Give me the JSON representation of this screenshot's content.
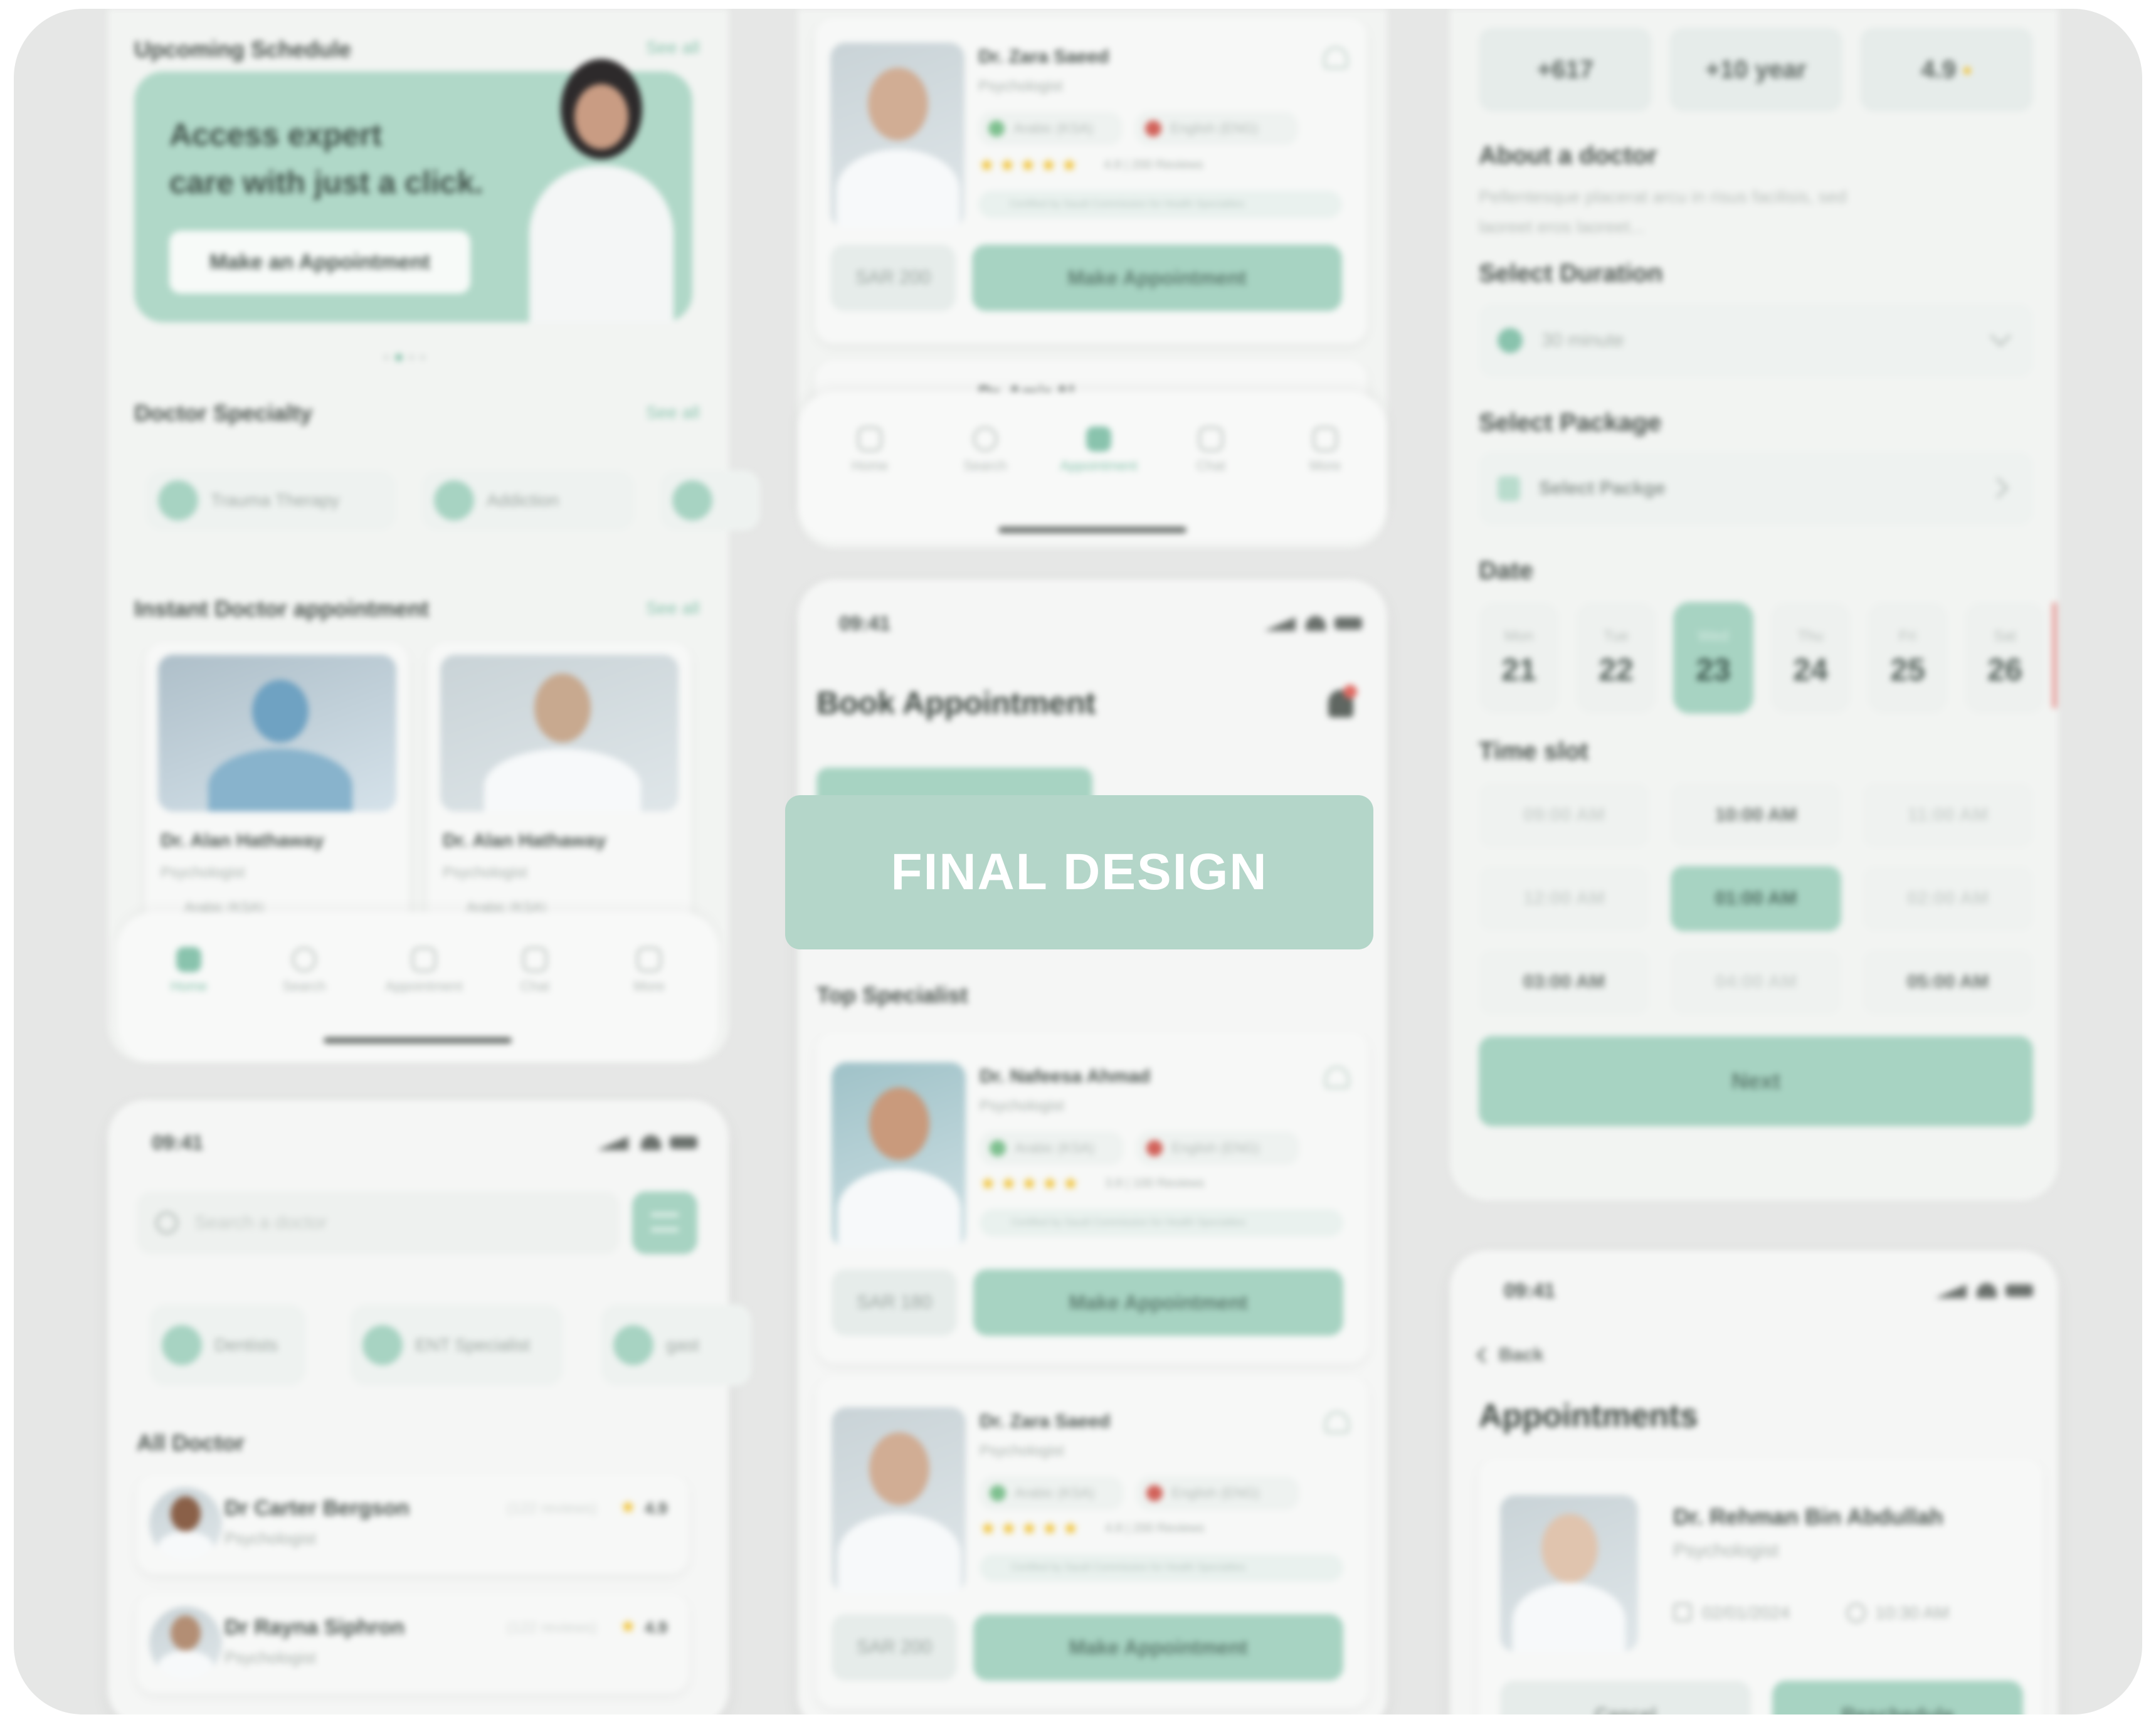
{
  "overlay": {
    "label": "FINAL DESIGN"
  },
  "colors": {
    "accent": "#a7d3c2",
    "accent_text": "#89c3ad",
    "background": "#e6e7e6",
    "star": "#f1c233"
  },
  "home": {
    "upcoming_title": "Upcoming Schedule",
    "see_all": "See all",
    "banner_line1": "Access expert",
    "banner_line2": "care with just a click.",
    "banner_button": "Make an Appointment",
    "specialty_title": "Doctor Specialty",
    "specialties": [
      {
        "label": "Trauma Therapy"
      },
      {
        "label": "Addiction"
      }
    ],
    "instant_title": "Instant Doctor appointment",
    "instant_doctors": [
      {
        "name": "Dr. Alan Hathaway",
        "role": "Psychologist",
        "lang": "Arabic (KSA)"
      },
      {
        "name": "Dr. Alan Hathaway",
        "role": "Psychologist",
        "lang": "Arabic (KSA)"
      }
    ],
    "nav": [
      {
        "label": "Home"
      },
      {
        "label": "Search"
      },
      {
        "label": "Appointment"
      },
      {
        "label": "Chat"
      },
      {
        "label": "More"
      }
    ]
  },
  "search_screen": {
    "time": "09:41",
    "search_placeholder": "Search a doctor",
    "chips": [
      {
        "label": "Dentists"
      },
      {
        "label": "ENT Specialist"
      },
      {
        "label": "gast"
      }
    ],
    "all_title": "All Doctor",
    "doctors": [
      {
        "name": "Dr Carter Bergson",
        "role": "Psychologist",
        "reviews": "(122 reviews)",
        "rating": "4.9"
      },
      {
        "name": "Dr Rayna Siphron",
        "role": "Psychologist",
        "reviews": "(122 reviews)",
        "rating": "4.9"
      }
    ]
  },
  "list_top": {
    "doctor": {
      "name": "Dr. Zara Saeed",
      "role": "Psychologist",
      "lang1": "Arabic (KSA)",
      "lang2": "English (ENG)",
      "rating_text": "4.8 | 200 Reviews",
      "cert": "Certified by Saudi Commission for Health Specialties",
      "price": "SAR 200",
      "button": "Make Appointment"
    },
    "next_name": "Dr. Amir Al",
    "nav": [
      {
        "label": "Home"
      },
      {
        "label": "Search"
      },
      {
        "label": "Appointment"
      },
      {
        "label": "Chat"
      },
      {
        "label": "More"
      }
    ]
  },
  "book": {
    "time": "09:41",
    "title": "Book Appointment",
    "top_specialist": "Top Specialist",
    "doctors": [
      {
        "name": "Dr. Nafeesa Ahmad",
        "role": "Psychologist",
        "lang1": "Arabic (KSA)",
        "lang2": "English (ENG)",
        "rating_text": "3.8 | 100 Reviews",
        "cert": "Certified by Saudi Commission for Health Specialties",
        "price": "SAR 180",
        "button": "Make Appointment"
      },
      {
        "name": "Dr. Zara Saeed",
        "role": "Psychologist",
        "lang1": "Arabic (KSA)",
        "lang2": "English (ENG)",
        "rating_text": "4.8 | 200 Reviews",
        "cert": "Certified by Saudi Commission for Health Specialties",
        "price": "SAR 200",
        "button": "Make Appointment"
      }
    ]
  },
  "details": {
    "stats": [
      {
        "value": "+617"
      },
      {
        "value": "+10 year"
      },
      {
        "value": "4.9"
      }
    ],
    "about_title": "About a doctor",
    "about_line1": "Pellentesque placerat arcu in risus facilisis, sed",
    "about_line2": "laoreet eros laoreet...",
    "duration_title": "Select Duration",
    "duration_value": "30 minute",
    "package_title": "Select Package",
    "package_value": "Select Packge",
    "date_title": "Date",
    "dates": [
      {
        "day": "Mon",
        "num": "21"
      },
      {
        "day": "Tue",
        "num": "22"
      },
      {
        "day": "Wed",
        "num": "23"
      },
      {
        "day": "Thu",
        "num": "24"
      },
      {
        "day": "Fri",
        "num": "25"
      },
      {
        "day": "Sat",
        "num": "26"
      }
    ],
    "selected_date_index": 2,
    "timeslot_title": "Time slot",
    "slots": [
      "09:00 AM",
      "10:00 AM",
      "11:00 AM",
      "12:00 AM",
      "01:00 AM",
      "02:00 AM",
      "03:00 AM",
      "04:00 AM",
      "05:00 AM"
    ],
    "selected_slot_index": 4,
    "next_button": "Next"
  },
  "appointments": {
    "time": "09:41",
    "back": "Back",
    "title": "Appointments",
    "doctor_name": "Dr. Rehman Bin Abdullah",
    "doctor_role": "Psychologist",
    "date": "02/01/2024",
    "time_value": "10:30 AM",
    "cancel": "Cancel",
    "reschedule": "Reschedule"
  }
}
